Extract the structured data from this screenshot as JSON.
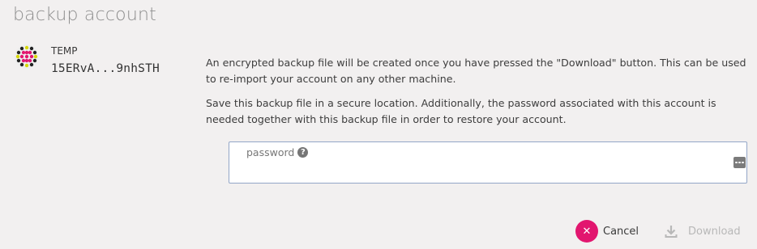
{
  "dialog": {
    "title": "backup account"
  },
  "account": {
    "name": "TEMP",
    "address": "15ERvA...9nhSTH"
  },
  "description": {
    "paragraph1": "An encrypted backup file will be created once you have pressed the \"Download\" button. This can be used to re-import your account on any other machine.",
    "paragraph2": "Save this backup file in a secure location. Additionally, the password associated with this account is needed together with this backup file in order to restore your account."
  },
  "password": {
    "label": "password",
    "value": "",
    "help_icon": "question-circle-icon",
    "keypad_icon": "ellipsis-keypad-icon"
  },
  "actions": {
    "cancel_label": "Cancel",
    "cancel_icon": "close-icon",
    "download_label": "Download",
    "download_icon": "download-icon",
    "download_enabled": false
  },
  "colors": {
    "cancel_accent": "#e2166f",
    "input_border": "#93a6c7",
    "disabled_text": "#b8b8b8"
  }
}
